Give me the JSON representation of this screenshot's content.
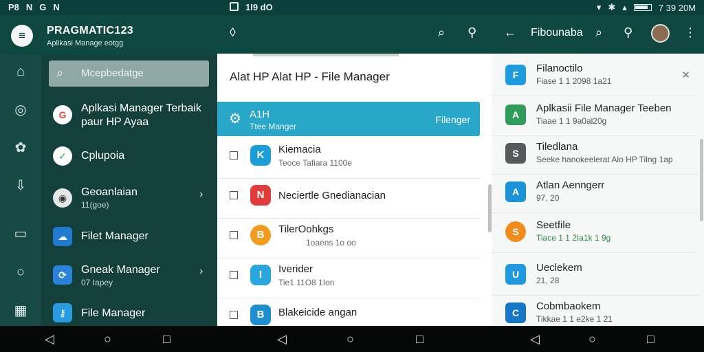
{
  "status_bar": {
    "left_icons": [
      "P8",
      "N",
      "G",
      "N"
    ],
    "middle_text": "1I9 dO",
    "time": "7 39 20M"
  },
  "drawer": {
    "app_title": "PRAGMATIC123",
    "app_subtitle": "Aplikasi Manage eotgg",
    "search_placeholder": "Mcepbedatge",
    "items": [
      {
        "label": "Aplkasi Manager Terbaik paur HP Ayaa",
        "sub": ""
      },
      {
        "label": "Cplupoia",
        "sub": ""
      },
      {
        "label": "Geoanlaian",
        "sub": "11(goe)"
      },
      {
        "label": "Filet Manager",
        "sub": ""
      },
      {
        "label": "Gneak Manager",
        "sub": "07 Iapey"
      },
      {
        "label": "File Manager",
        "sub": ""
      }
    ]
  },
  "rail": {
    "icons": [
      "home-icon",
      "target-icon",
      "puzzle-icon",
      "download-box-icon",
      "document-icon",
      "circle-icon",
      "grid-icon"
    ]
  },
  "panel_middle": {
    "heading": "Alat HP Alat HP - File Manager",
    "selected": {
      "title": "A1H",
      "sub": "Ttee Manger",
      "right": "Filenger"
    },
    "rows": [
      {
        "title": "Kiemacia",
        "sub": "Teoce Tafiara 1100e",
        "color": "#1b9ed7",
        "glyph": "K"
      },
      {
        "title": "Neciertle Gnedianacian",
        "sub": "",
        "color": "#e23b3b",
        "glyph": "N"
      },
      {
        "title": "TilerOohkgs",
        "sub": "1oaens 1o oo",
        "color": "#f39b1e",
        "glyph": "B"
      },
      {
        "title": "Iverider",
        "sub": "Tie1 11O8 1Ion",
        "color": "#2aa6e1",
        "glyph": "I"
      },
      {
        "title": "Blakeicide angan",
        "sub": "",
        "color": "#1d8fd0",
        "glyph": "B"
      }
    ]
  },
  "panel_right": {
    "title": "Fibounaba",
    "rows": [
      {
        "title": "Filanoctilo",
        "sub": "Fiase 1 1 2098 1a21",
        "color": "#1c9be0",
        "glyph": "F"
      },
      {
        "title": "Aplkasii File Manager Teeben",
        "sub": "Tiaae 1 1 9a0al20g",
        "color": "#2f9d59",
        "glyph": "A"
      },
      {
        "title": "Tiledlana",
        "sub": "Seeke hanokeelerat Alo HP Tilng 1ap",
        "color": "#555a5c",
        "glyph": "S"
      },
      {
        "title": "Atlan Aenngerr",
        "sub": "97, 20",
        "color": "#1a93d8",
        "glyph": "A"
      },
      {
        "title": "Seetfile",
        "sub": "Tiace 1 1 2Ia1k 1 9g",
        "color": "#f28b1e",
        "glyph": "S"
      },
      {
        "title": "Ueclekem",
        "sub": "21, 28",
        "color": "#1f9ae0",
        "glyph": "U"
      },
      {
        "title": "Cobmbaokem",
        "sub": "Tikkae 1 1 e2ke 1 21",
        "color": "#1677c9",
        "glyph": "C"
      }
    ]
  }
}
